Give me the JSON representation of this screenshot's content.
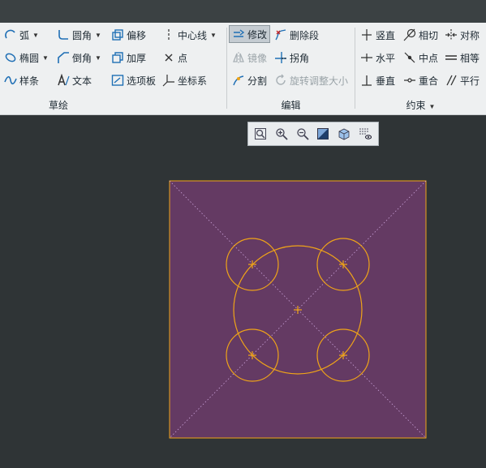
{
  "sketch_group": {
    "label": "草绘",
    "items": [
      {
        "label": "弧",
        "icon": "arc-icon",
        "dropdown": true
      },
      {
        "label": "圆角",
        "icon": "fillet-icon",
        "dropdown": true
      },
      {
        "label": "偏移",
        "icon": "offset-icon"
      },
      {
        "label": "中心线",
        "icon": "centerline-icon",
        "dropdown": true
      },
      {
        "label": "椭圆",
        "icon": "ellipse-icon",
        "dropdown": true
      },
      {
        "label": "倒角",
        "icon": "chamfer-icon",
        "dropdown": true
      },
      {
        "label": "加厚",
        "icon": "thicken-icon"
      },
      {
        "label": "点",
        "icon": "point-icon"
      },
      {
        "label": "样条",
        "icon": "spline-icon"
      },
      {
        "label": "文本",
        "icon": "text-icon"
      },
      {
        "label": "选项板",
        "icon": "palette-icon"
      },
      {
        "label": "坐标系",
        "icon": "coordinate-system-icon"
      }
    ]
  },
  "edit_group": {
    "label": "编辑",
    "items": [
      {
        "label": "修改",
        "icon": "modify-icon",
        "pressed": true
      },
      {
        "label": "删除段",
        "icon": "delete-segment-icon"
      },
      {
        "label": "镜像",
        "icon": "mirror-icon",
        "disabled": true
      },
      {
        "label": "拐角",
        "icon": "corner-icon"
      },
      {
        "label": "分割",
        "icon": "divide-icon"
      },
      {
        "label": "旋转调整大小",
        "icon": "rotate-resize-icon",
        "disabled": true
      }
    ]
  },
  "constrain_group": {
    "label": "约束",
    "items": [
      {
        "label": "竖直",
        "icon": "vertical-icon"
      },
      {
        "label": "相切",
        "icon": "tangent-icon"
      },
      {
        "label": "对称",
        "icon": "symmetric-icon"
      },
      {
        "label": "水平",
        "icon": "horizontal-icon"
      },
      {
        "label": "中点",
        "icon": "midpoint-icon"
      },
      {
        "label": "相等",
        "icon": "equal-icon"
      },
      {
        "label": "垂直",
        "icon": "perpendicular-icon"
      },
      {
        "label": "重合",
        "icon": "coincident-icon"
      },
      {
        "label": "平行",
        "icon": "parallel-icon"
      }
    ]
  },
  "view_toolbar": [
    "refit-icon",
    "zoom-in-icon",
    "zoom-out-icon",
    "display-style-icon",
    "saved-orientation-icon",
    "sketch-display-filter-icon"
  ],
  "colors": {
    "canvas_bg": "#2f3436",
    "sketch_fill": "#643a63",
    "sketch_line": "#f0a418",
    "ribbon_bg": "#eef0f1"
  }
}
